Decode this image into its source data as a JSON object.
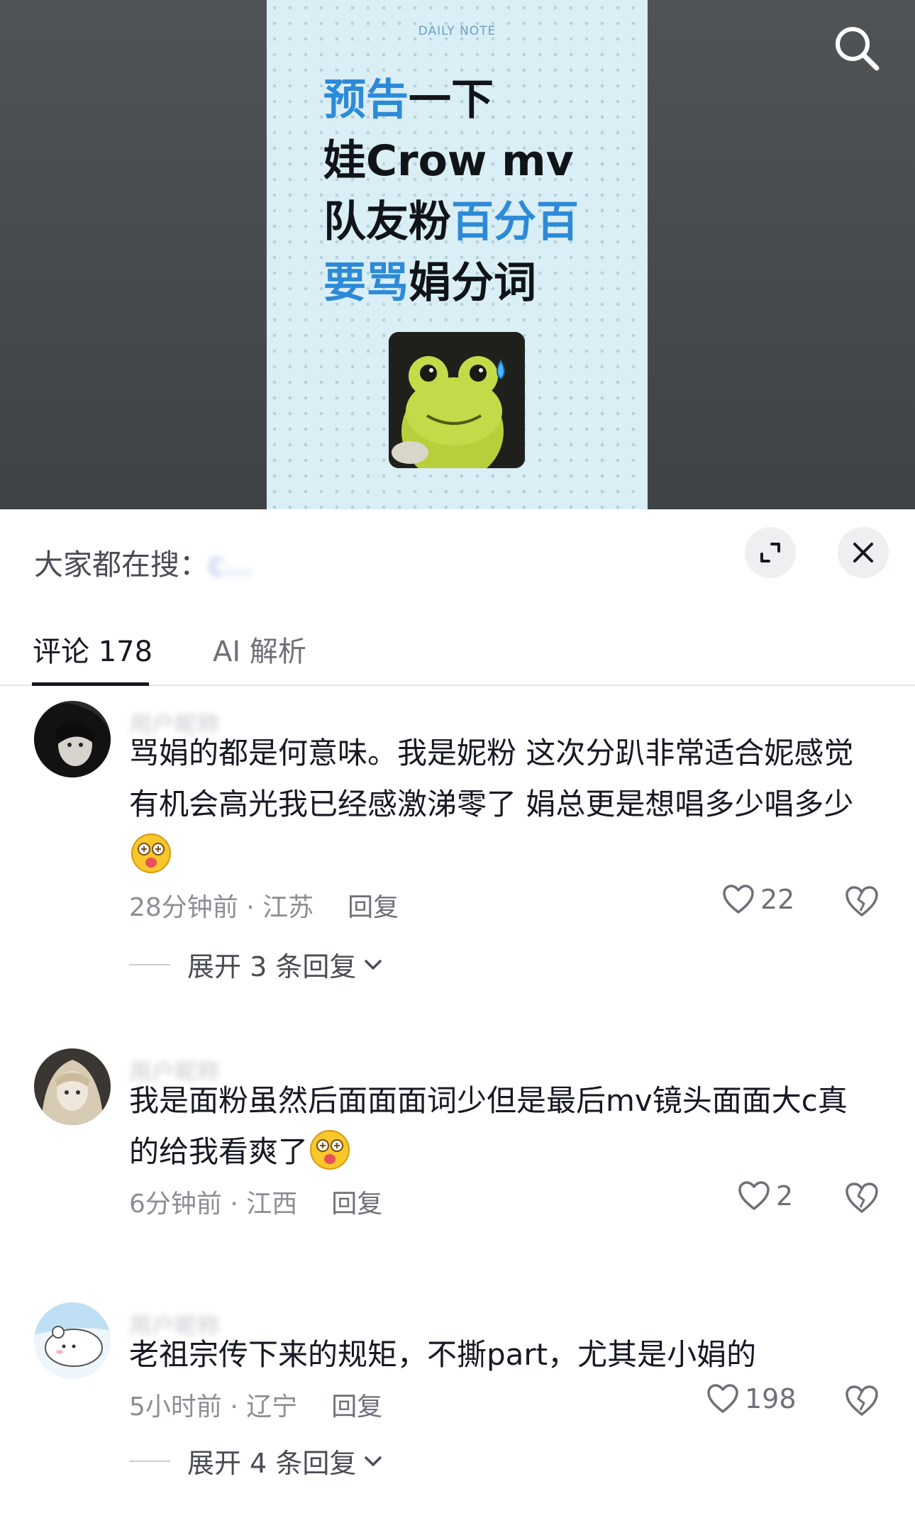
{
  "note": {
    "label": "DAILY NOTE",
    "line1": {
      "hl": "预告",
      "rest": "一下"
    },
    "line2": "娃Crow mv",
    "line3": {
      "pre": "队友粉",
      "hl": "百分百"
    },
    "line4": {
      "hl": "要骂",
      "rest": "娟分词"
    }
  },
  "sheet": {
    "search_prefix": "大家都在搜：",
    "search_query": "c..."
  },
  "tabs": {
    "comments": "评论 178",
    "ai": "AI 解析"
  },
  "comments": [
    {
      "text": "骂娟的都是何意味。我是妮粉 这次分趴非常适合妮感觉有机会高光我已经感激涕零了 娟总更是想唱多少唱多少",
      "time": "28分钟前 · 江苏",
      "reply": "回复",
      "likes": "22",
      "expand": "展开 3 条回复"
    },
    {
      "text": "我是面粉虽然后面面面词少但是最后mv镜头面面大c真的给我看爽了",
      "time": "6分钟前 · 江西",
      "reply": "回复",
      "likes": "2"
    },
    {
      "text": "老祖宗传下来的规矩，不撕part，尤其是小娟的",
      "time": "5小时前 · 辽宁",
      "reply": "回复",
      "likes": "198",
      "expand": "展开 4 条回复"
    }
  ],
  "icons": {
    "search": "search-icon",
    "expand": "expand-icon",
    "close": "close-icon",
    "heart": "heart-icon",
    "broken_heart": "broken-heart-icon",
    "chevron": "chevron-down-icon"
  },
  "colors": {
    "accent_blue": "#2d8ad8",
    "text_primary": "#161823",
    "text_secondary": "#8c8e96"
  }
}
